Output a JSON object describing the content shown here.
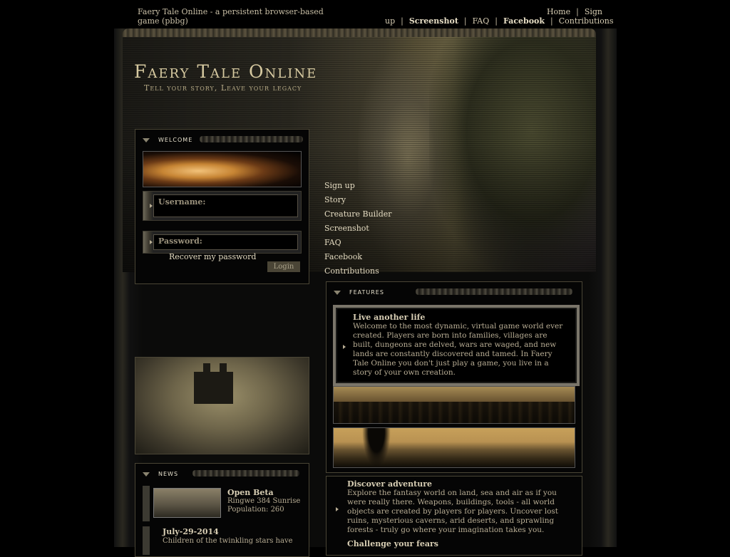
{
  "site": {
    "description": "Faery Tale Online - a persistent browser-based game (pbbg)",
    "logo": "Faery Tale Online",
    "tagline": "Tell your story, Leave your legacy"
  },
  "topnav": {
    "home": "Home",
    "signup_1": "Sign",
    "signup_2": "up",
    "screenshot": "Screenshot",
    "faq": "FAQ",
    "facebook": "Facebook",
    "contributions": "Contributions",
    "sep": "|"
  },
  "mainnav": {
    "items": [
      "Sign up",
      "Story",
      "Creature Builder",
      "Screenshot",
      "FAQ",
      "Facebook",
      "Contributions"
    ]
  },
  "welcome": {
    "title": "Welcome",
    "username_label": "Username:",
    "password_label": "Password:",
    "recover": "Recover my password",
    "login": "Login"
  },
  "news": {
    "title": "News",
    "items": [
      {
        "title": "Open Beta",
        "line1": "Ringwe 384 Sunrise",
        "line2": "Population: 260"
      },
      {
        "title": "July-29-2014",
        "line1": "Children of the twinkling stars have"
      }
    ]
  },
  "features": {
    "title": "Features",
    "card": {
      "title": "Live another life",
      "text": "Welcome to the most dynamic, virtual game world ever created. Players are born into families, villages are built, dungeons are delved, wars are waged, and new lands are constantly discovered and tamed. In Faery Tale Online you don't just play a game, you live in a story of your own creation."
    }
  },
  "adventure": {
    "title": "Discover adventure",
    "text": "Explore the fantasy world on land, sea and air as if you were really there. Weapons, buildings, tools - all world objects are created by players for players. Uncover lost ruins, mysterious caverns, arid deserts, and sprawling forests - truly go where your imagination takes you.",
    "title2": "Challenge your fears"
  }
}
